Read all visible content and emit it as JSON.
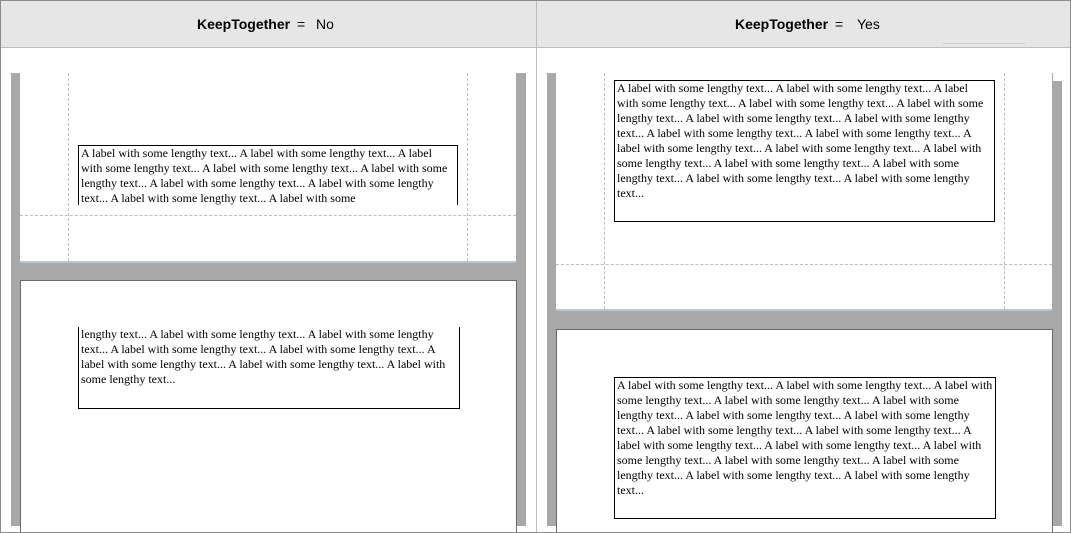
{
  "left_panel": {
    "header": {
      "property": "KeepTogether",
      "equals": "=",
      "value": "No"
    },
    "top_page_label_text": "A label with some lengthy text... A label with some lengthy text... A label with some lengthy text... A label with some lengthy text... A label with some lengthy text... A label with some lengthy text... A label with some lengthy text... A label with some lengthy text... A label with some",
    "bottom_page_label_text": "lengthy text... A label with some lengthy text... A label with some lengthy text... A label with some lengthy text... A label with some lengthy text... A label with some lengthy text... A label with some lengthy text... A label with some lengthy text..."
  },
  "right_panel": {
    "header": {
      "property": "KeepTogether",
      "equals": "=",
      "value": "Yes"
    },
    "top_page_label_text": "A label with some lengthy text... A label with some lengthy text... A label with some lengthy text... A label with some lengthy text... A label with some lengthy text... A label with some lengthy text... A label with some lengthy text... A label with some lengthy text... A label with some lengthy text... A label with some lengthy text... A label with some lengthy text... A label with some lengthy text... A label with some lengthy text... A label with some lengthy text... A label with some lengthy text... A label with some lengthy text...",
    "bottom_page_label_text": "A label with some lengthy text... A label with some lengthy text... A label with some lengthy text... A label with some lengthy text... A label with some lengthy text... A label with some lengthy text... A label with some lengthy text... A label with some lengthy text... A label with some lengthy text... A label with some lengthy text... A label with some lengthy text... A label with some lengthy text... A label with some lengthy text... A label with some lengthy text... A label with some lengthy text... A label with some lengthy text..."
  }
}
